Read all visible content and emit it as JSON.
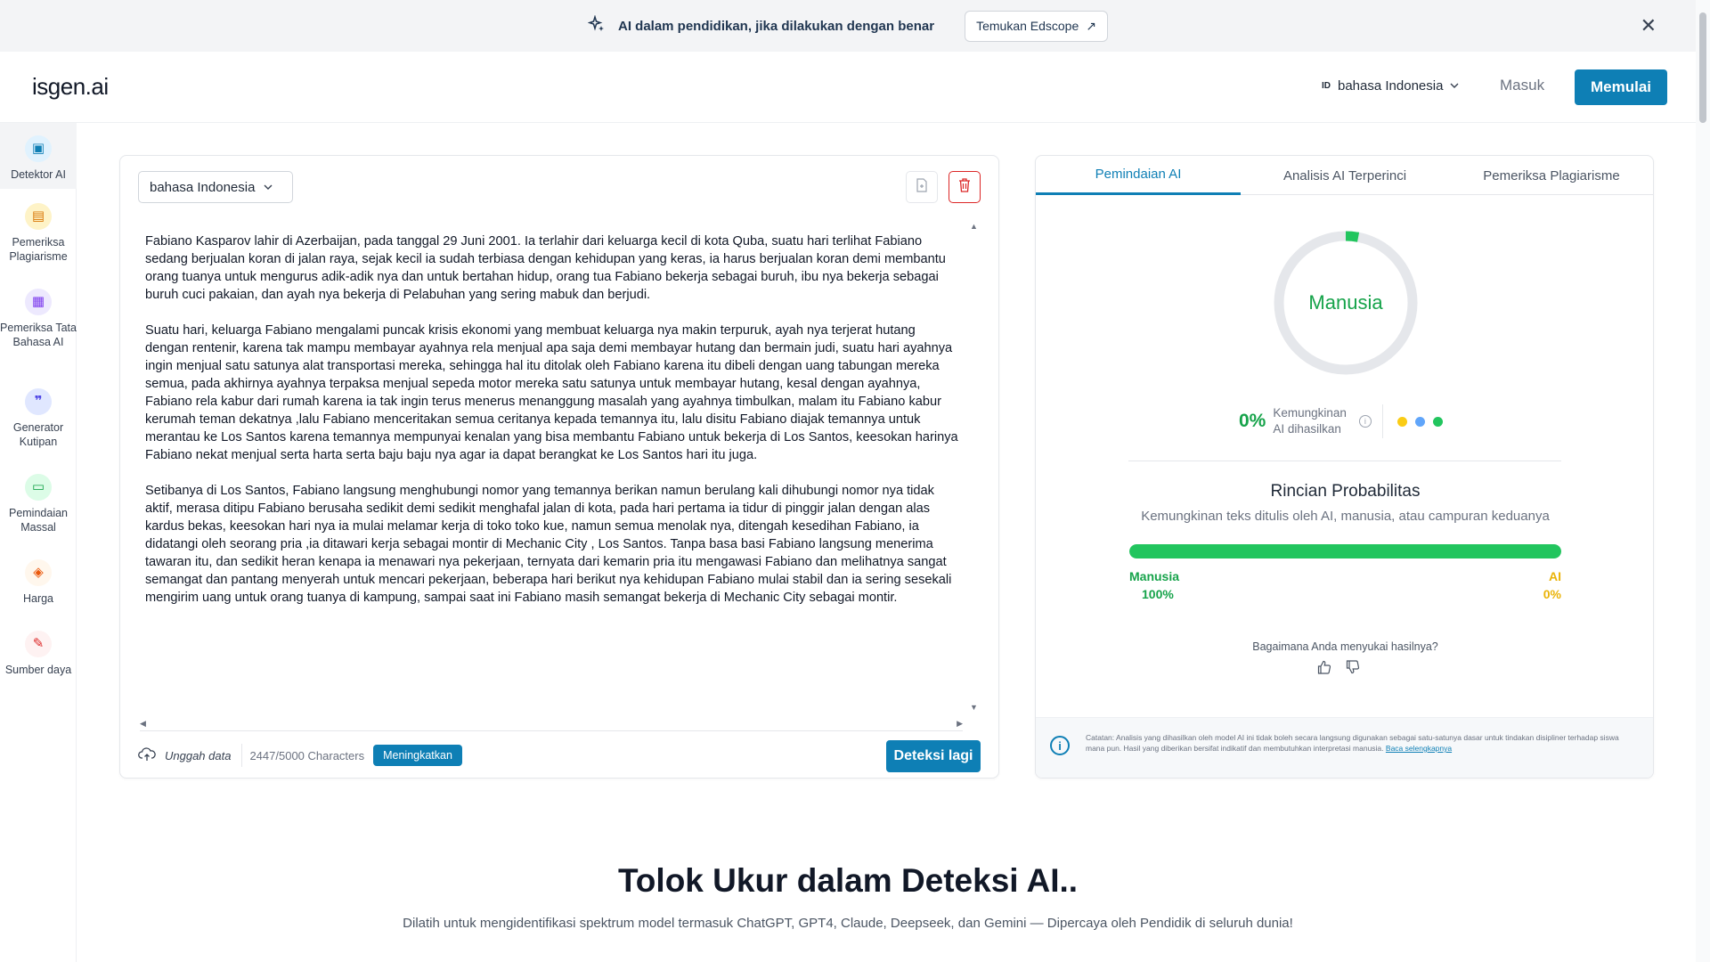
{
  "banner": {
    "text": "AI dalam pendidikan, jika dilakukan dengan benar",
    "button": "Temukan Edscope",
    "close": "✕"
  },
  "header": {
    "logo": "isgen.ai",
    "lang_code": "ID",
    "language": "bahasa Indonesia",
    "login": "Masuk",
    "start": "Memulai"
  },
  "sidebar": {
    "items": [
      {
        "label": "Detektor AI",
        "icon": "detector-icon"
      },
      {
        "label": "Pemeriksa Plagiarisme",
        "icon": "plagiarism-icon"
      },
      {
        "label": "Pemeriksa Tata Bahasa AI",
        "icon": "grammar-icon"
      },
      {
        "label": "Generator Kutipan",
        "icon": "quote-icon"
      },
      {
        "label": "Pemindaian Massal",
        "icon": "folder-icon"
      },
      {
        "label": "Harga",
        "icon": "price-tag-icon"
      },
      {
        "label": "Sumber daya",
        "icon": "resources-icon"
      }
    ]
  },
  "editor": {
    "language": "bahasa Indonesia",
    "paragraphs": [
      "Fabiano Kasparov lahir di Azerbaijan, pada tanggal 29 Juni 2001. Ia terlahir dari keluarga kecil di kota Quba, suatu hari terlihat Fabiano sedang berjualan koran di jalan raya, sejak kecil ia sudah terbiasa dengan kehidupan yang keras, ia harus berjualan koran demi membantu orang tuanya untuk mengurus adik-adik nya dan untuk bertahan hidup, orang tua Fabiano bekerja sebagai buruh, ibu nya bekerja sebagai buruh cuci pakaian, dan ayah nya bekerja di Pelabuhan yang sering mabuk dan berjudi.",
      "Suatu hari, keluarga Fabiano mengalami puncak krisis ekonomi yang membuat keluarga nya makin terpuruk, ayah nya terjerat hutang dengan rentenir, karena tak mampu membayar ayahnya rela menjual apa saja demi membayar hutang dan bermain judi, suatu hari ayahnya ingin menjual satu satunya alat transportasi mereka, sehingga hal itu ditolak oleh Fabiano karena itu dibeli dengan uang tabungan mereka semua, pada akhirnya ayahnya terpaksa menjual sepeda motor mereka satu satunya untuk membayar hutang, kesal dengan ayahnya, Fabiano rela kabur dari rumah karena ia tak ingin terus menerus menanggung masalah yang ayahnya timbulkan, malam itu Fabiano kabur kerumah teman dekatnya ,lalu Fabiano menceritakan semua ceritanya kepada temannya itu, lalu disitu Fabiano diajak temannya untuk merantau ke Los Santos karena temannya mempunyai kenalan yang bisa membantu Fabiano untuk bekerja di Los Santos, keesokan harinya Fabiano nekat menjual serta harta serta baju baju nya agar ia dapat berangkat ke Los Santos hari itu juga.",
      "Setibanya di Los Santos, Fabiano langsung menghubungi nomor yang temannya berikan namun berulang kali dihubungi nomor nya tidak aktif, merasa ditipu Fabiano berusaha sedikit demi sedikit menghafal jalan di kota, pada hari pertama ia tidur di pinggir jalan dengan alas kardus bekas, keesokan hari nya ia mulai melamar kerja di toko toko kue, namun semua menolak nya, ditengah kesedihan Fabiano, ia didatangi oleh seorang pria ,ia ditawari kerja sebagai montir di Mechanic City , Los Santos. Tanpa basa basi Fabiano langsung menerima tawaran itu, dan sedikit heran kenapa ia menawari nya pekerjaan, ternyata dari kemarin pria itu mengawasi Fabiano dan melihatnya sangat semangat dan pantang menyerah untuk mencari pekerjaan, beberapa hari berikut nya kehidupan Fabiano mulai stabil dan ia sering sesekali mengirim uang untuk orang tuanya di kampung, sampai saat ini Fabiano masih semangat bekerja di Mechanic City sebagai montir."
    ],
    "upload": "Unggah data",
    "char_count": "2447/5000 Characters",
    "upgrade": "Meningkatkan",
    "detect": "Deteksi lagi"
  },
  "result": {
    "tabs": [
      "Pemindaian AI",
      "Analisis AI Terperinci",
      "Pemeriksa Plagiarisme"
    ],
    "gauge_label": "Manusia",
    "ai_fraction": 0.03,
    "ai_percent": "0%",
    "prob_label_1": "Kemungkinan",
    "prob_label_2": "AI dihasilkan",
    "dot_colors": [
      "#facc15",
      "#60a5fa",
      "#22c55e"
    ],
    "breakdown_title": "Rincian Probabilitas",
    "breakdown_sub": "Kemungkinan teks ditulis oleh AI, manusia, atau campuran keduanya",
    "human_share": 100,
    "human_label": "Manusia",
    "human_pct": "100%",
    "ai_label": "AI",
    "ai_pct": "0%",
    "feedback": "Bagaimana Anda menyukai hasilnya?",
    "note": "Catatan: Analisis yang dihasilkan oleh model AI ini tidak boleh secara langsung digunakan sebagai satu-satunya dasar untuk tindakan disipliner terhadap siswa mana pun. Hasil yang diberikan bersifat indikatif dan membutuhkan interpretasi manusia.",
    "note_link": "Baca selengkapnya"
  },
  "bottom": {
    "title": "Tolok Ukur dalam Deteksi AI..",
    "subtitle": "Dilatih untuk mengidentifikasi spektrum model termasuk ChatGPT, GPT4, Claude, Deepseek, dan Gemini — Dipercaya oleh Pendidik di seluruh dunia!"
  },
  "colors": {
    "accent": "#0e7fb5",
    "human_green": "#22c55e",
    "ai_yellow": "#eab308",
    "delete_red": "#dc2626"
  }
}
